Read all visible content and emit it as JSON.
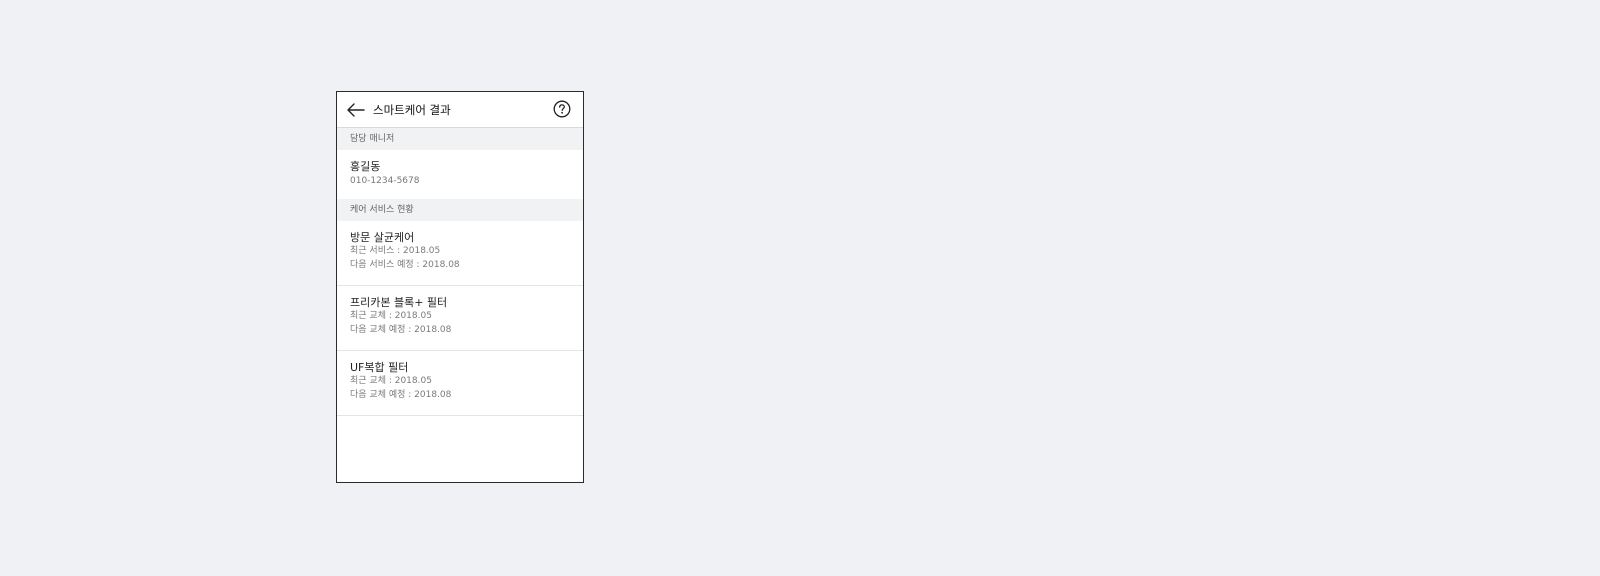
{
  "header": {
    "title": "스마트케어 결과",
    "back_icon": "arrow-left-icon",
    "help_icon": "question-circle-icon"
  },
  "manager_section": {
    "label": "담당 매니저",
    "name": "홍길동",
    "phone": "010-1234-5678"
  },
  "service_section": {
    "label": "케어 서비스 현황",
    "items": [
      {
        "name": "방문 살균케어",
        "recent": "최근 서비스 : 2018.05",
        "next": "다음 서비스 예정 : 2018.08"
      },
      {
        "name": "프리카본 블록+ 필터",
        "recent": "최근 교체 : 2018.05",
        "next": "다음 교체 예정 : 2018.08"
      },
      {
        "name": "UF복합 필터",
        "recent": "최근 교체 : 2018.05",
        "next": "다음 교체 예정 : 2018.08"
      }
    ]
  },
  "colors": {
    "page_background": "#f0f1f5",
    "section_background": "#f1f2f4",
    "text_primary": "#222222",
    "text_secondary": "#777777"
  }
}
